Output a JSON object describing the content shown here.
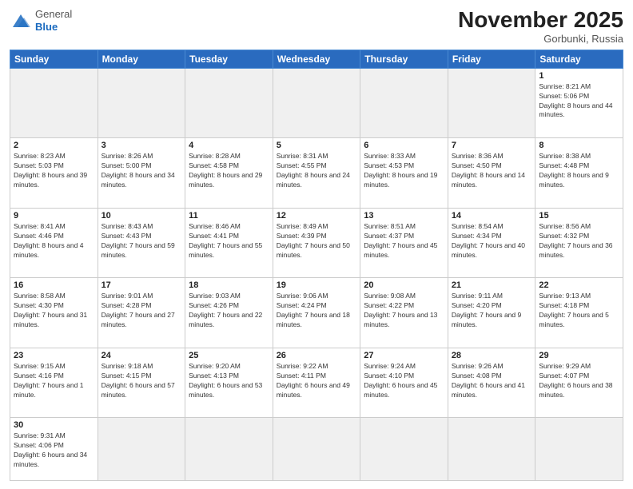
{
  "header": {
    "logo_general": "General",
    "logo_blue": "Blue",
    "month": "November 2025",
    "location": "Gorbunki, Russia"
  },
  "weekdays": [
    "Sunday",
    "Monday",
    "Tuesday",
    "Wednesday",
    "Thursday",
    "Friday",
    "Saturday"
  ],
  "weeks": [
    [
      {
        "day": "",
        "empty": true
      },
      {
        "day": "",
        "empty": true
      },
      {
        "day": "",
        "empty": true
      },
      {
        "day": "",
        "empty": true
      },
      {
        "day": "",
        "empty": true
      },
      {
        "day": "",
        "empty": true
      },
      {
        "day": "1",
        "sunrise": "Sunrise: 8:21 AM",
        "sunset": "Sunset: 5:06 PM",
        "daylight": "Daylight: 8 hours and 44 minutes."
      }
    ],
    [
      {
        "day": "2",
        "sunrise": "Sunrise: 8:23 AM",
        "sunset": "Sunset: 5:03 PM",
        "daylight": "Daylight: 8 hours and 39 minutes."
      },
      {
        "day": "3",
        "sunrise": "Sunrise: 8:26 AM",
        "sunset": "Sunset: 5:00 PM",
        "daylight": "Daylight: 8 hours and 34 minutes."
      },
      {
        "day": "4",
        "sunrise": "Sunrise: 8:28 AM",
        "sunset": "Sunset: 4:58 PM",
        "daylight": "Daylight: 8 hours and 29 minutes."
      },
      {
        "day": "5",
        "sunrise": "Sunrise: 8:31 AM",
        "sunset": "Sunset: 4:55 PM",
        "daylight": "Daylight: 8 hours and 24 minutes."
      },
      {
        "day": "6",
        "sunrise": "Sunrise: 8:33 AM",
        "sunset": "Sunset: 4:53 PM",
        "daylight": "Daylight: 8 hours and 19 minutes."
      },
      {
        "day": "7",
        "sunrise": "Sunrise: 8:36 AM",
        "sunset": "Sunset: 4:50 PM",
        "daylight": "Daylight: 8 hours and 14 minutes."
      },
      {
        "day": "8",
        "sunrise": "Sunrise: 8:38 AM",
        "sunset": "Sunset: 4:48 PM",
        "daylight": "Daylight: 8 hours and 9 minutes."
      }
    ],
    [
      {
        "day": "9",
        "sunrise": "Sunrise: 8:41 AM",
        "sunset": "Sunset: 4:46 PM",
        "daylight": "Daylight: 8 hours and 4 minutes."
      },
      {
        "day": "10",
        "sunrise": "Sunrise: 8:43 AM",
        "sunset": "Sunset: 4:43 PM",
        "daylight": "Daylight: 7 hours and 59 minutes."
      },
      {
        "day": "11",
        "sunrise": "Sunrise: 8:46 AM",
        "sunset": "Sunset: 4:41 PM",
        "daylight": "Daylight: 7 hours and 55 minutes."
      },
      {
        "day": "12",
        "sunrise": "Sunrise: 8:49 AM",
        "sunset": "Sunset: 4:39 PM",
        "daylight": "Daylight: 7 hours and 50 minutes."
      },
      {
        "day": "13",
        "sunrise": "Sunrise: 8:51 AM",
        "sunset": "Sunset: 4:37 PM",
        "daylight": "Daylight: 7 hours and 45 minutes."
      },
      {
        "day": "14",
        "sunrise": "Sunrise: 8:54 AM",
        "sunset": "Sunset: 4:34 PM",
        "daylight": "Daylight: 7 hours and 40 minutes."
      },
      {
        "day": "15",
        "sunrise": "Sunrise: 8:56 AM",
        "sunset": "Sunset: 4:32 PM",
        "daylight": "Daylight: 7 hours and 36 minutes."
      }
    ],
    [
      {
        "day": "16",
        "sunrise": "Sunrise: 8:58 AM",
        "sunset": "Sunset: 4:30 PM",
        "daylight": "Daylight: 7 hours and 31 minutes."
      },
      {
        "day": "17",
        "sunrise": "Sunrise: 9:01 AM",
        "sunset": "Sunset: 4:28 PM",
        "daylight": "Daylight: 7 hours and 27 minutes."
      },
      {
        "day": "18",
        "sunrise": "Sunrise: 9:03 AM",
        "sunset": "Sunset: 4:26 PM",
        "daylight": "Daylight: 7 hours and 22 minutes."
      },
      {
        "day": "19",
        "sunrise": "Sunrise: 9:06 AM",
        "sunset": "Sunset: 4:24 PM",
        "daylight": "Daylight: 7 hours and 18 minutes."
      },
      {
        "day": "20",
        "sunrise": "Sunrise: 9:08 AM",
        "sunset": "Sunset: 4:22 PM",
        "daylight": "Daylight: 7 hours and 13 minutes."
      },
      {
        "day": "21",
        "sunrise": "Sunrise: 9:11 AM",
        "sunset": "Sunset: 4:20 PM",
        "daylight": "Daylight: 7 hours and 9 minutes."
      },
      {
        "day": "22",
        "sunrise": "Sunrise: 9:13 AM",
        "sunset": "Sunset: 4:18 PM",
        "daylight": "Daylight: 7 hours and 5 minutes."
      }
    ],
    [
      {
        "day": "23",
        "sunrise": "Sunrise: 9:15 AM",
        "sunset": "Sunset: 4:16 PM",
        "daylight": "Daylight: 7 hours and 1 minute."
      },
      {
        "day": "24",
        "sunrise": "Sunrise: 9:18 AM",
        "sunset": "Sunset: 4:15 PM",
        "daylight": "Daylight: 6 hours and 57 minutes."
      },
      {
        "day": "25",
        "sunrise": "Sunrise: 9:20 AM",
        "sunset": "Sunset: 4:13 PM",
        "daylight": "Daylight: 6 hours and 53 minutes."
      },
      {
        "day": "26",
        "sunrise": "Sunrise: 9:22 AM",
        "sunset": "Sunset: 4:11 PM",
        "daylight": "Daylight: 6 hours and 49 minutes."
      },
      {
        "day": "27",
        "sunrise": "Sunrise: 9:24 AM",
        "sunset": "Sunset: 4:10 PM",
        "daylight": "Daylight: 6 hours and 45 minutes."
      },
      {
        "day": "28",
        "sunrise": "Sunrise: 9:26 AM",
        "sunset": "Sunset: 4:08 PM",
        "daylight": "Daylight: 6 hours and 41 minutes."
      },
      {
        "day": "29",
        "sunrise": "Sunrise: 9:29 AM",
        "sunset": "Sunset: 4:07 PM",
        "daylight": "Daylight: 6 hours and 38 minutes."
      }
    ],
    [
      {
        "day": "30",
        "sunrise": "Sunrise: 9:31 AM",
        "sunset": "Sunset: 4:06 PM",
        "daylight": "Daylight: 6 hours and 34 minutes."
      },
      {
        "day": "",
        "empty": true
      },
      {
        "day": "",
        "empty": true
      },
      {
        "day": "",
        "empty": true
      },
      {
        "day": "",
        "empty": true
      },
      {
        "day": "",
        "empty": true
      },
      {
        "day": "",
        "empty": true
      }
    ]
  ]
}
